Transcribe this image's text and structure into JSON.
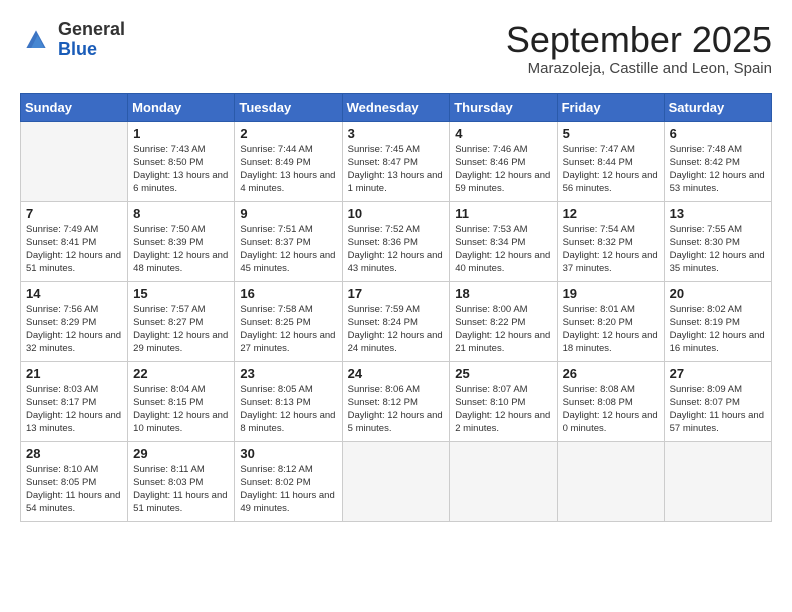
{
  "header": {
    "logo_general": "General",
    "logo_blue": "Blue",
    "month_title": "September 2025",
    "location": "Marazoleja, Castille and Leon, Spain"
  },
  "calendar": {
    "days_of_week": [
      "Sunday",
      "Monday",
      "Tuesday",
      "Wednesday",
      "Thursday",
      "Friday",
      "Saturday"
    ],
    "weeks": [
      [
        {
          "day": "",
          "empty": true
        },
        {
          "day": "1",
          "sunrise": "7:43 AM",
          "sunset": "8:50 PM",
          "daylight": "13 hours and 6 minutes."
        },
        {
          "day": "2",
          "sunrise": "7:44 AM",
          "sunset": "8:49 PM",
          "daylight": "13 hours and 4 minutes."
        },
        {
          "day": "3",
          "sunrise": "7:45 AM",
          "sunset": "8:47 PM",
          "daylight": "13 hours and 1 minute."
        },
        {
          "day": "4",
          "sunrise": "7:46 AM",
          "sunset": "8:46 PM",
          "daylight": "12 hours and 59 minutes."
        },
        {
          "day": "5",
          "sunrise": "7:47 AM",
          "sunset": "8:44 PM",
          "daylight": "12 hours and 56 minutes."
        },
        {
          "day": "6",
          "sunrise": "7:48 AM",
          "sunset": "8:42 PM",
          "daylight": "12 hours and 53 minutes."
        }
      ],
      [
        {
          "day": "7",
          "sunrise": "7:49 AM",
          "sunset": "8:41 PM",
          "daylight": "12 hours and 51 minutes."
        },
        {
          "day": "8",
          "sunrise": "7:50 AM",
          "sunset": "8:39 PM",
          "daylight": "12 hours and 48 minutes."
        },
        {
          "day": "9",
          "sunrise": "7:51 AM",
          "sunset": "8:37 PM",
          "daylight": "12 hours and 45 minutes."
        },
        {
          "day": "10",
          "sunrise": "7:52 AM",
          "sunset": "8:36 PM",
          "daylight": "12 hours and 43 minutes."
        },
        {
          "day": "11",
          "sunrise": "7:53 AM",
          "sunset": "8:34 PM",
          "daylight": "12 hours and 40 minutes."
        },
        {
          "day": "12",
          "sunrise": "7:54 AM",
          "sunset": "8:32 PM",
          "daylight": "12 hours and 37 minutes."
        },
        {
          "day": "13",
          "sunrise": "7:55 AM",
          "sunset": "8:30 PM",
          "daylight": "12 hours and 35 minutes."
        }
      ],
      [
        {
          "day": "14",
          "sunrise": "7:56 AM",
          "sunset": "8:29 PM",
          "daylight": "12 hours and 32 minutes."
        },
        {
          "day": "15",
          "sunrise": "7:57 AM",
          "sunset": "8:27 PM",
          "daylight": "12 hours and 29 minutes."
        },
        {
          "day": "16",
          "sunrise": "7:58 AM",
          "sunset": "8:25 PM",
          "daylight": "12 hours and 27 minutes."
        },
        {
          "day": "17",
          "sunrise": "7:59 AM",
          "sunset": "8:24 PM",
          "daylight": "12 hours and 24 minutes."
        },
        {
          "day": "18",
          "sunrise": "8:00 AM",
          "sunset": "8:22 PM",
          "daylight": "12 hours and 21 minutes."
        },
        {
          "day": "19",
          "sunrise": "8:01 AM",
          "sunset": "8:20 PM",
          "daylight": "12 hours and 18 minutes."
        },
        {
          "day": "20",
          "sunrise": "8:02 AM",
          "sunset": "8:19 PM",
          "daylight": "12 hours and 16 minutes."
        }
      ],
      [
        {
          "day": "21",
          "sunrise": "8:03 AM",
          "sunset": "8:17 PM",
          "daylight": "12 hours and 13 minutes."
        },
        {
          "day": "22",
          "sunrise": "8:04 AM",
          "sunset": "8:15 PM",
          "daylight": "12 hours and 10 minutes."
        },
        {
          "day": "23",
          "sunrise": "8:05 AM",
          "sunset": "8:13 PM",
          "daylight": "12 hours and 8 minutes."
        },
        {
          "day": "24",
          "sunrise": "8:06 AM",
          "sunset": "8:12 PM",
          "daylight": "12 hours and 5 minutes."
        },
        {
          "day": "25",
          "sunrise": "8:07 AM",
          "sunset": "8:10 PM",
          "daylight": "12 hours and 2 minutes."
        },
        {
          "day": "26",
          "sunrise": "8:08 AM",
          "sunset": "8:08 PM",
          "daylight": "12 hours and 0 minutes."
        },
        {
          "day": "27",
          "sunrise": "8:09 AM",
          "sunset": "8:07 PM",
          "daylight": "11 hours and 57 minutes."
        }
      ],
      [
        {
          "day": "28",
          "sunrise": "8:10 AM",
          "sunset": "8:05 PM",
          "daylight": "11 hours and 54 minutes."
        },
        {
          "day": "29",
          "sunrise": "8:11 AM",
          "sunset": "8:03 PM",
          "daylight": "11 hours and 51 minutes."
        },
        {
          "day": "30",
          "sunrise": "8:12 AM",
          "sunset": "8:02 PM",
          "daylight": "11 hours and 49 minutes."
        },
        {
          "day": "",
          "empty": true
        },
        {
          "day": "",
          "empty": true
        },
        {
          "day": "",
          "empty": true
        },
        {
          "day": "",
          "empty": true
        }
      ]
    ]
  }
}
